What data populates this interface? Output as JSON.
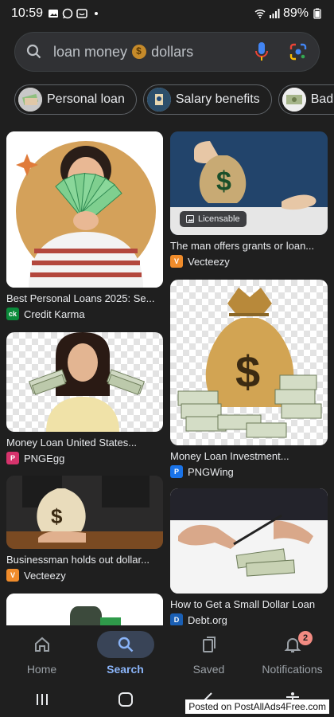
{
  "status": {
    "time": "10:59",
    "battery": "89%"
  },
  "search": {
    "query": "loan money",
    "query_suffix": "dollars"
  },
  "chips": [
    {
      "label": "Personal loan"
    },
    {
      "label": "Salary benefits"
    },
    {
      "label": "Bad c"
    }
  ],
  "results": [
    {
      "title": "Best Personal Loans 2025: Se...",
      "source": "Credit Karma",
      "source_icon": "ck"
    },
    {
      "title": "The man offers grants or loan...",
      "source": "Vecteezy",
      "source_icon": "V",
      "badge": "Licensable"
    },
    {
      "title": "Money Loan United States...",
      "source": "PNGEgg",
      "source_icon": "P"
    },
    {
      "title": "Money Loan Investment...",
      "source": "PNGWing",
      "source_icon": "P"
    },
    {
      "title": "Businessman holds out dollar...",
      "source": "Vecteezy",
      "source_icon": "V"
    },
    {
      "title": "How to Get a Small Dollar Loan",
      "source": "Debt.org",
      "source_icon": "D"
    }
  ],
  "nav": {
    "home": "Home",
    "search": "Search",
    "saved": "Saved",
    "notifications": "Notifications",
    "notifications_badge": "2"
  },
  "watermark": "Posted on PostAllAds4Free.com",
  "colors": {
    "accent": "#8ab4f8",
    "background": "#1f1f1f",
    "badge": "#f28b82"
  }
}
